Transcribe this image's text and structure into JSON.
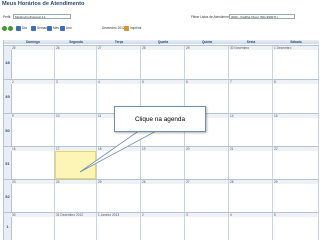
{
  "page": {
    "title": "Meus Horários de Atendimento"
  },
  "filters": {
    "profile_label": "Perfil:",
    "profile_value": "Médico/profissional 1.1",
    "agenda_label": "Filtrar Listas de Atendimento:",
    "agenda_value": "0000 - Padilha Oliver (MG-999071)"
  },
  "toolbar": {
    "day_label": "Dia",
    "week_label": "Semana",
    "month_label": "Mês",
    "year_label": "Ano",
    "period_label": "Dezembro 2012",
    "print_label": "Imprimir"
  },
  "calendar": {
    "days": [
      "Domingo",
      "Segunda",
      "Terça",
      "Quarta",
      "Quinta",
      "Sexta",
      "Sábado"
    ],
    "weeks": [
      {
        "num": "48",
        "dates": [
          "25",
          "26",
          "27",
          "28",
          "29",
          "30 Novembro",
          "1 Dezembro"
        ]
      },
      {
        "num": "49",
        "dates": [
          "2",
          "3",
          "4",
          "5",
          "6",
          "7",
          "8"
        ]
      },
      {
        "num": "50",
        "dates": [
          "9",
          "10",
          "11",
          "12",
          "13",
          "14",
          "15"
        ]
      },
      {
        "num": "51",
        "dates": [
          "16",
          "17",
          "18",
          "19",
          "20",
          "21",
          "22"
        ]
      },
      {
        "num": "52",
        "dates": [
          "23",
          "24",
          "25",
          "26",
          "27",
          "28",
          "29"
        ]
      },
      {
        "num": "1",
        "dates": [
          "30",
          "31 Dezembro 2012",
          "1 Janeiro 2013",
          "2",
          "3",
          "4",
          "5"
        ]
      }
    ],
    "selected_week": 3,
    "selected_day": 1
  },
  "callout": {
    "text": "Clique na agenda"
  },
  "colors": {
    "selected_cell": "#fdf5b5",
    "header_text": "#2c4a76"
  }
}
